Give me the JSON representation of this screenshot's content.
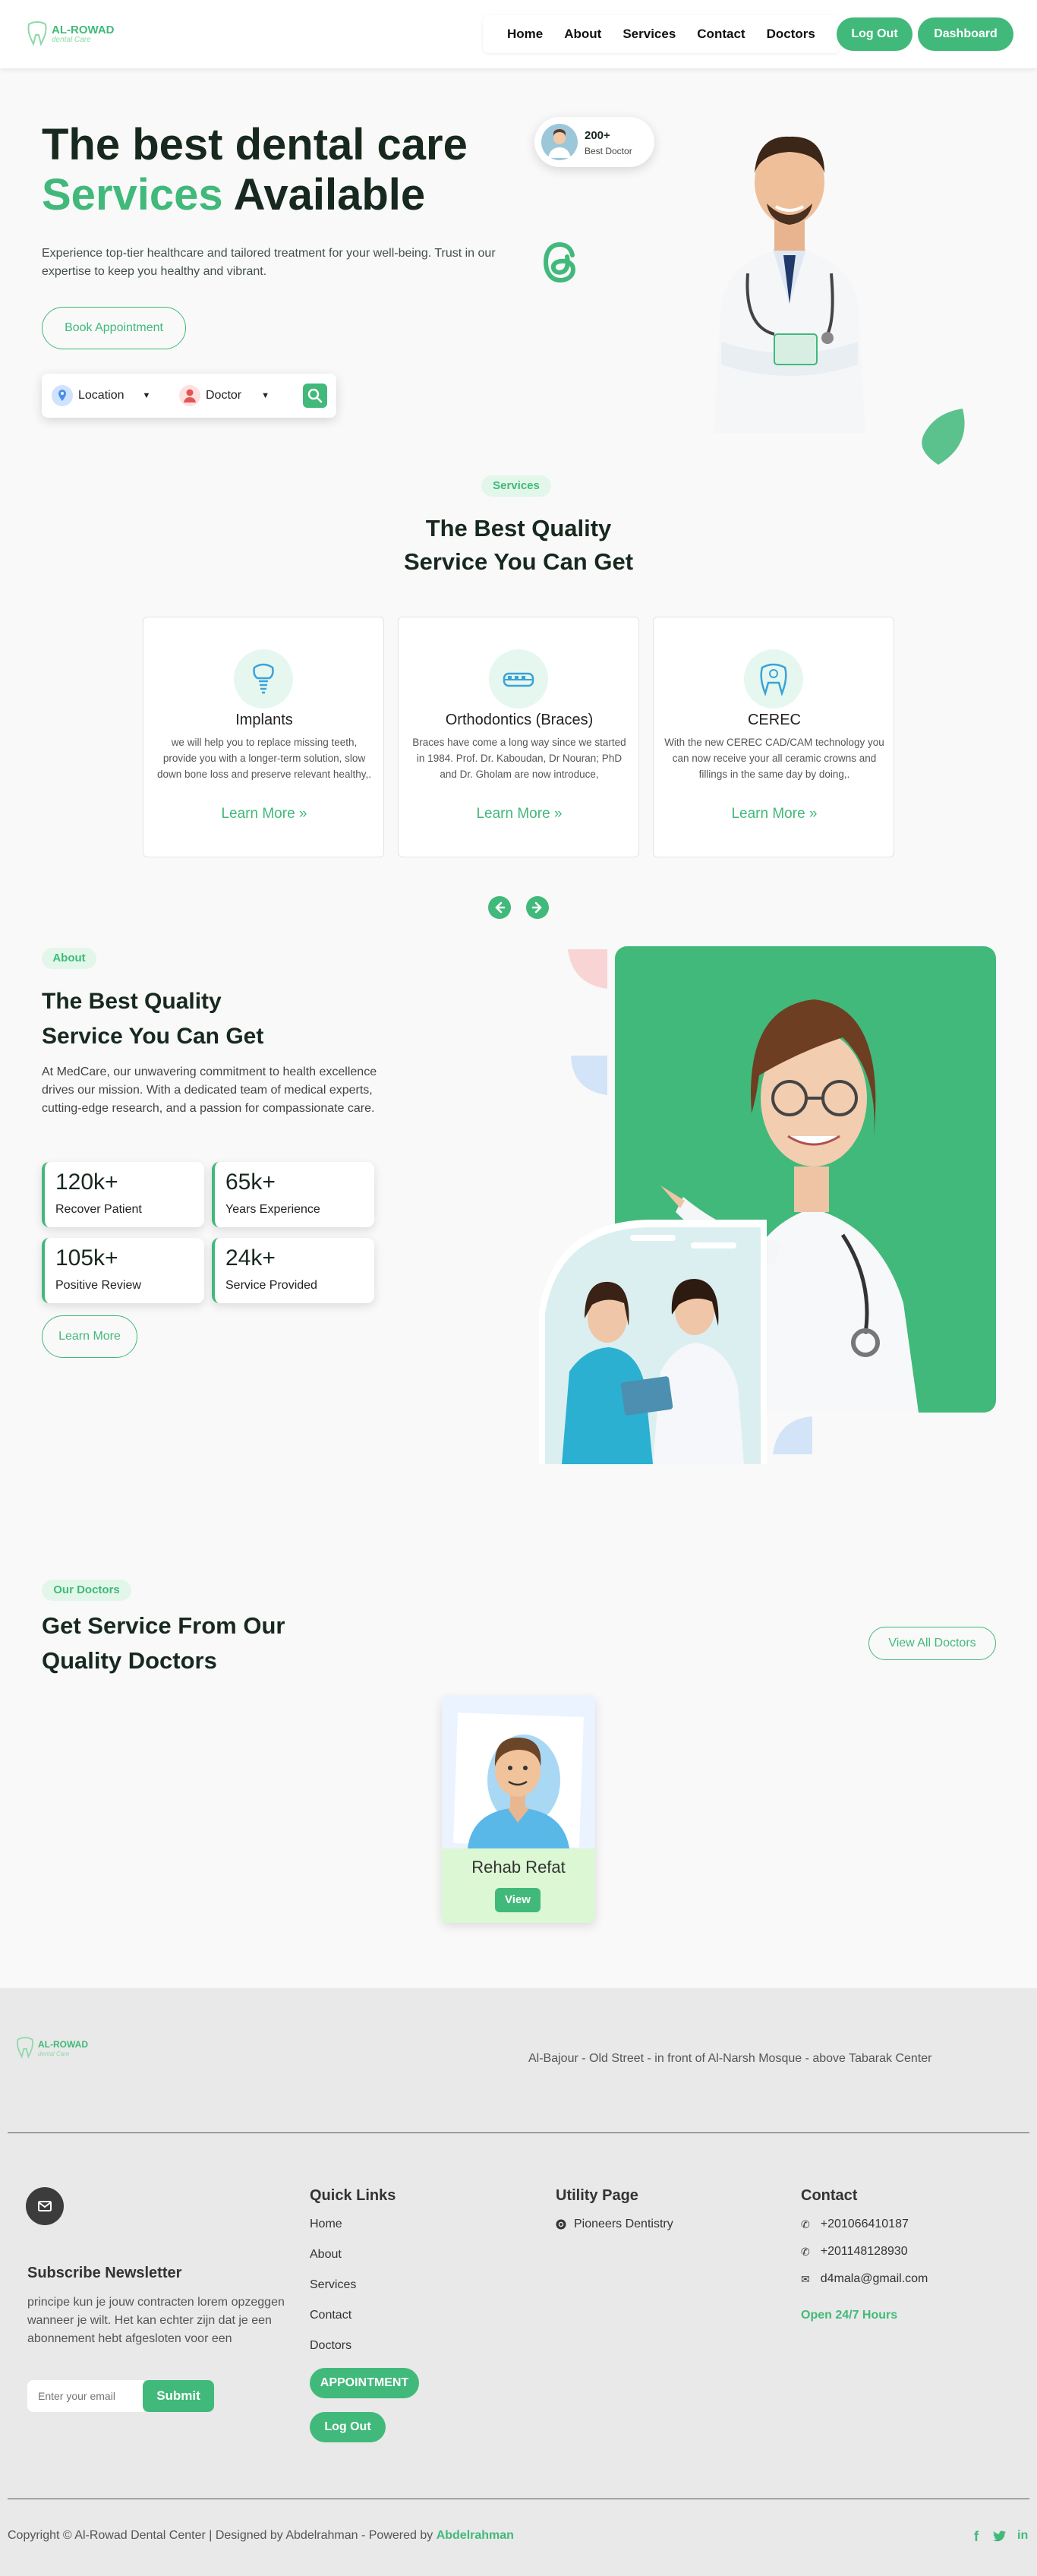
{
  "header": {
    "logo_name": "AL-ROWAD",
    "logo_tagline": "dental Care",
    "nav": [
      "Home",
      "About",
      "Services",
      "Contact",
      "Doctors"
    ],
    "logout_label": "Log Out",
    "dashboard_label": "Dashboard"
  },
  "hero": {
    "title_line1": "The best dental care",
    "title_green": "Services",
    "title_rest": "Available",
    "description": "Experience top-tier healthcare and tailored treatment for your well-being. Trust in our expertise to keep you healthy and vibrant.",
    "book_label": "Book Appointment",
    "location_label": "Location",
    "doctor_label": "Doctor",
    "badge_count": "200+",
    "badge_label": "Best Doctor"
  },
  "services": {
    "chip": "Services",
    "title_line1": "The Best Quality",
    "title_line2": "Service You Can Get",
    "cards": [
      {
        "title": "Implants",
        "desc": "we will help you to replace missing teeth, provide you with a longer-term solution, slow down bone loss and preserve relevant healthy,.",
        "more": "Learn More »",
        "icon": "implant-icon"
      },
      {
        "title": "Orthodontics (Braces)",
        "desc": "Braces have come a long way since we started in 1984. Prof. Dr. Kaboudan, Dr Nouran; PhD and Dr. Gholam are now introduce,",
        "more": "Learn More »",
        "icon": "braces-icon"
      },
      {
        "title": "CEREC",
        "desc": "With the new CEREC CAD/CAM technology you can now receive your all ceramic crowns and fillings in the same day by doing,.",
        "more": "Learn More »",
        "icon": "tooth-icon"
      }
    ]
  },
  "about": {
    "chip": "About",
    "title_line1": "The Best Quality",
    "title_line2": "Service You Can Get",
    "description": "At MedCare, our unwavering commitment to health excellence drives our mission. With a dedicated team of medical experts, cutting-edge research, and a passion for compassionate care.",
    "stats": [
      {
        "value": "120k+",
        "label": "Recover Patient"
      },
      {
        "value": "65k+",
        "label": "Years Experience"
      },
      {
        "value": "105k+",
        "label": "Positive Review"
      },
      {
        "value": "24k+",
        "label": "Service Provided"
      }
    ],
    "learn_more": "Learn More"
  },
  "doctors": {
    "chip": "Our Doctors",
    "title_line1": "Get Service From Our",
    "title_line2": "Quality Doctors",
    "view_all": "View All Doctors",
    "card_name": "Rehab Refat",
    "card_button": "View"
  },
  "footer": {
    "address": "Al-Bajour - Old Street - in front of Al-Narsh Mosque - above Tabarak Center",
    "newsletter_title": "Subscribe Newsletter",
    "newsletter_text": "principe kun je jouw contracten lorem opzeggen wanneer je wilt. Het kan echter zijn dat je een abonnement hebt afgesloten voor een",
    "email_placeholder": "Enter your email",
    "submit_label": "Submit",
    "quick_links_title": "Quick Links",
    "quick_links": [
      "Home",
      "About",
      "Services",
      "Contact",
      "Doctors"
    ],
    "appointment_label": "APPOINTMENT",
    "logout_label": "Log Out",
    "utility_title": "Utility Page",
    "utility_item": "Pioneers Dentistry",
    "contact_title": "Contact",
    "phone1": "+201066410187",
    "phone2": "+201148128930",
    "email": "d4mala@gmail.com",
    "hours": "Open 24/7 Hours",
    "copyright": "Copyright © Al-Rowad Dental Center | Designed by Abdelrahman - Powered by",
    "powered_by": "Abdelrahman"
  },
  "colors": {
    "accent": "#41b97a",
    "dark": "#17291f",
    "footer_bg": "#e9e9e9"
  }
}
